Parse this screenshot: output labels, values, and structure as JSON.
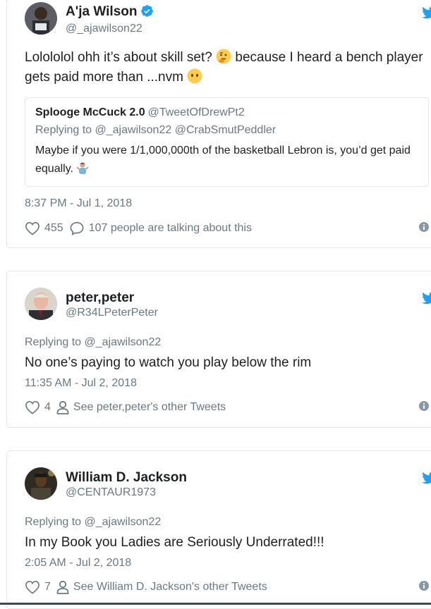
{
  "tweets": [
    {
      "name": "A'ja Wilson",
      "handle": "@_ajawilson22",
      "verified": true,
      "text_a": "Lolololol ohh it’s about skill set? ",
      "emoji_a": "thinking-face",
      "text_b": " because I heard a bench player gets paid more than ...nvm ",
      "emoji_b": "no-mouth-face",
      "quote": {
        "name": "Splooge McCuck 2.0",
        "handle": "@TweetOfDrewPt2",
        "replying_label": "Replying to",
        "replying_to": "@_ajawilson22 @CrabSmutPeddler",
        "text": "Maybe if you were 1/1,000,000th of the basketball Lebron is, you’d get paid equally. ",
        "emoji": "man-shrugging"
      },
      "time": "8:37 PM - Jul 1, 2018",
      "likes": "455",
      "second_action": "107 people are talking about this"
    },
    {
      "name": "peter,peter",
      "handle": "@R34LPeterPeter",
      "replying_label": "Replying to",
      "replying_to": "@_ajawilson22",
      "text": "No one’s paying to watch you play below the rim",
      "time": "11:35 AM - Jul 2, 2018",
      "likes": "4",
      "second_action": "See peter,peter's other Tweets"
    },
    {
      "name": "William D. Jackson",
      "handle": "@CENTAUR1973",
      "replying_label": "Replying to",
      "replying_to": "@_ajawilson22",
      "text": "In my Book you Ladies are Seriously Underrated!!!",
      "time": "2:05 AM - Jul 2, 2018",
      "likes": "7",
      "second_action": "See William D. Jackson's other Tweets"
    }
  ],
  "colors": {
    "twitter_blue": "#1da1f2",
    "secondary_text": "#697882",
    "border": "#e1e8ed"
  }
}
